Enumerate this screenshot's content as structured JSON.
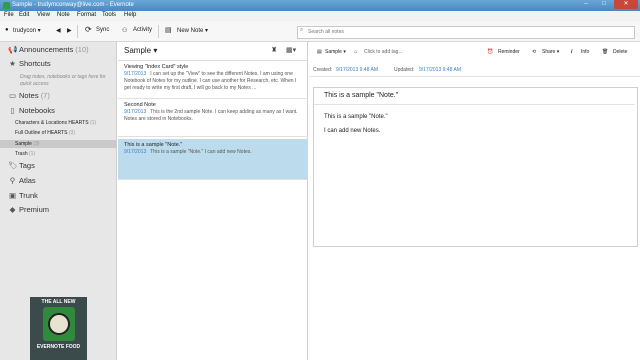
{
  "window": {
    "title": "Sample - trudymconway@live.com - Evernote",
    "buttons": [
      "–",
      "□",
      "✕"
    ]
  },
  "menu": [
    "File",
    "Edit",
    "View",
    "Note",
    "Format",
    "Tools",
    "Help"
  ],
  "toolbar": {
    "user": "trudycon",
    "sync": "Sync",
    "activity": "Activity",
    "new_note": "New Note",
    "search_placeholder": "Search all notes"
  },
  "sidebar": {
    "announcements": "Announcements",
    "announcements_count": "(10)",
    "shortcuts": "Shortcuts",
    "shortcuts_hint": "Drag notes, notebooks or tags here for quick access",
    "notes": "Notes",
    "notes_count": "(7)",
    "notebooks": "Notebooks",
    "notebook_items": [
      {
        "label": "Characters & Locations HEARTS",
        "count": "(1)"
      },
      {
        "label": "Full Outline of HEARTS",
        "count": "(3)"
      },
      {
        "label": "Sample",
        "count": "(3)"
      },
      {
        "label": "Trash",
        "count": "(1)"
      }
    ],
    "tags": "Tags",
    "atlas": "Atlas",
    "trunk": "Trunk",
    "premium": "Premium",
    "ad_top": "THE ALL NEW",
    "ad_bottom": "EVERNOTE FOOD"
  },
  "notelist": {
    "notebook": "Sample ▾",
    "notes": [
      {
        "title": "Viewing \"Index Card\" style",
        "date": "9/17/2013",
        "snippet": "I can set up the \"View\" to see the different Notes. I am using one Notebook of Notes for my outline. I can use another for Research, etc. When I get ready to write my first draft, I will go back to my Notes ..."
      },
      {
        "title": "Second Note",
        "date": "9/17/2013",
        "snippet": "This is the 2nd sample Note. I can keep adding as many as I want. Notes are stored in Notebooks."
      },
      {
        "title": "This is a sample \"Note.\"",
        "date": "9/17/2013",
        "snippet": "This is a sample \"Note.\" I can add new Notes."
      }
    ]
  },
  "editor": {
    "notebook": "Sample ▾",
    "add_tag": "Click to add tag...",
    "reminder": "Reminder",
    "share": "Share ▾",
    "info": "Info",
    "delete": "Delete",
    "created_label": "Created:",
    "created": "9/17/2013 9:48 AM",
    "updated_label": "Updated:",
    "updated": "9/17/2013 9:48 AM",
    "note_title": "This is a sample \"Note.\"",
    "body": [
      "This is a sample \"Note.\"",
      "I can add new Notes."
    ]
  }
}
